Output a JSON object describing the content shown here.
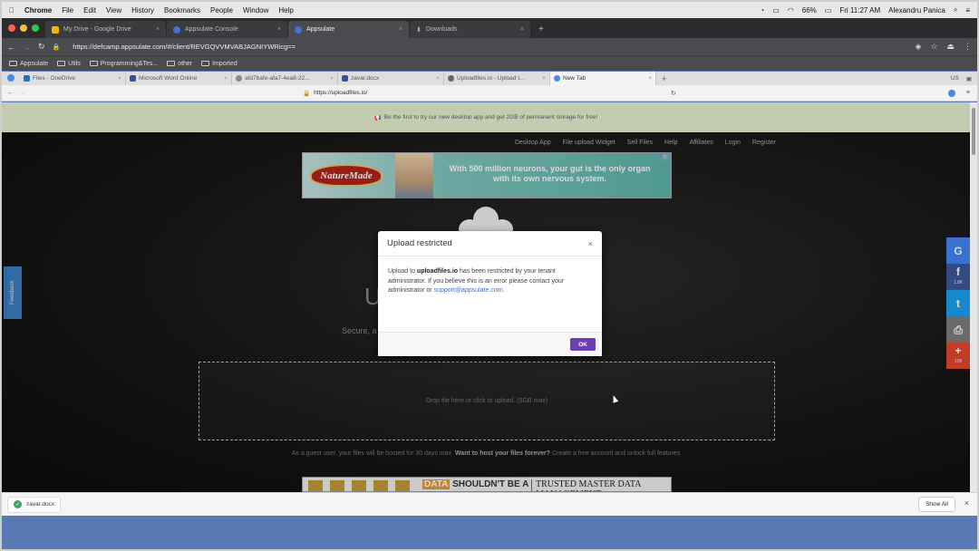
{
  "menubar": {
    "apple": "",
    "app": "Chrome",
    "items": [
      "File",
      "Edit",
      "View",
      "History",
      "Bookmarks",
      "People",
      "Window",
      "Help"
    ],
    "battery": "66%",
    "clock": "Fri 11:27 AM",
    "user": "Alexandru Panica"
  },
  "outer_tabs": [
    {
      "label": "My Drive - Google Drive",
      "color": "#f2b600"
    },
    {
      "label": "Appsulate Console",
      "color": "#4a6fd8"
    },
    {
      "label": "Appsulate",
      "color": "#4a6fd8"
    },
    {
      "label": "Downloads",
      "color": "#cccccc"
    }
  ],
  "outer_url": "https://defcamp.appsulate.com/#/client/REVGQVVMVABJAGNIYWRicg==",
  "bookmarks": [
    "Appsulate",
    "Utils",
    "Programming&Tes...",
    "other",
    "Imported"
  ],
  "inner_tabs": [
    {
      "label": "Files - OneDrive",
      "color": "#2a6ebb"
    },
    {
      "label": "Microsoft Word Online",
      "color": "#2b579a"
    },
    {
      "label": "afd7bafe-afa7-4ea8-22...",
      "color": "#888888"
    },
    {
      "label": "zavar.docx",
      "color": "#2b579a"
    },
    {
      "label": "Uploadfiles.io - Upload t...",
      "color": "#666666"
    },
    {
      "label": "New Tab",
      "color": "#4a86e8"
    }
  ],
  "inner_lang": "US",
  "inner_url": "https://uploadfiles.io/",
  "banner": "Be the first to try our new desktop app and get 2GB of permanent storage for free!",
  "site_nav": [
    "Desktop App",
    "File upload Widget",
    "Sell Files",
    "Help",
    "Affiliates",
    "Login",
    "Register"
  ],
  "ad_top": {
    "brand": "NatureMade",
    "text": "With 500 million neurons, your gut is the only organ with its own nervous system."
  },
  "bg_title": "U                          e",
  "bg_sub": "Secure, a                                                          A, to B...",
  "dropzone": "Drop file here or click to upload. (5GB max)",
  "guest": {
    "pre": "As a guest user, your files will be hosted for 30 days max.",
    "bold": "Want to host your files forever?",
    "post": "Create a free account and unlock full features"
  },
  "ad_bottom": {
    "badge": "DATA",
    "text1": "SHOULDN'T BE A",
    "text2": "TRUSTED MASTER DATA MANAGEMENT"
  },
  "feedback": "Feedback",
  "share": [
    {
      "icon": "G",
      "count": "",
      "color": "#4285f4"
    },
    {
      "icon": "f",
      "count": "1.8K",
      "color": "#3b5998"
    },
    {
      "icon": "t",
      "count": "",
      "color": "#1da1f2"
    },
    {
      "icon": "⎙",
      "count": "",
      "color": "#7d7d7d"
    },
    {
      "icon": "+",
      "count": "108",
      "color": "#e4482f"
    }
  ],
  "modal": {
    "title": "Upload restricted",
    "close": "×",
    "pre": "Upload to",
    "domain": "uploadfiles.io",
    "mid": "has been restricted by your tenant administrator. If you believe this is an error please contact your administrator or",
    "email": "support@appsulate.com",
    "post": ".",
    "ok": "OK"
  },
  "downloads": {
    "file": "zavar.docx",
    "show_all": "Show All"
  }
}
